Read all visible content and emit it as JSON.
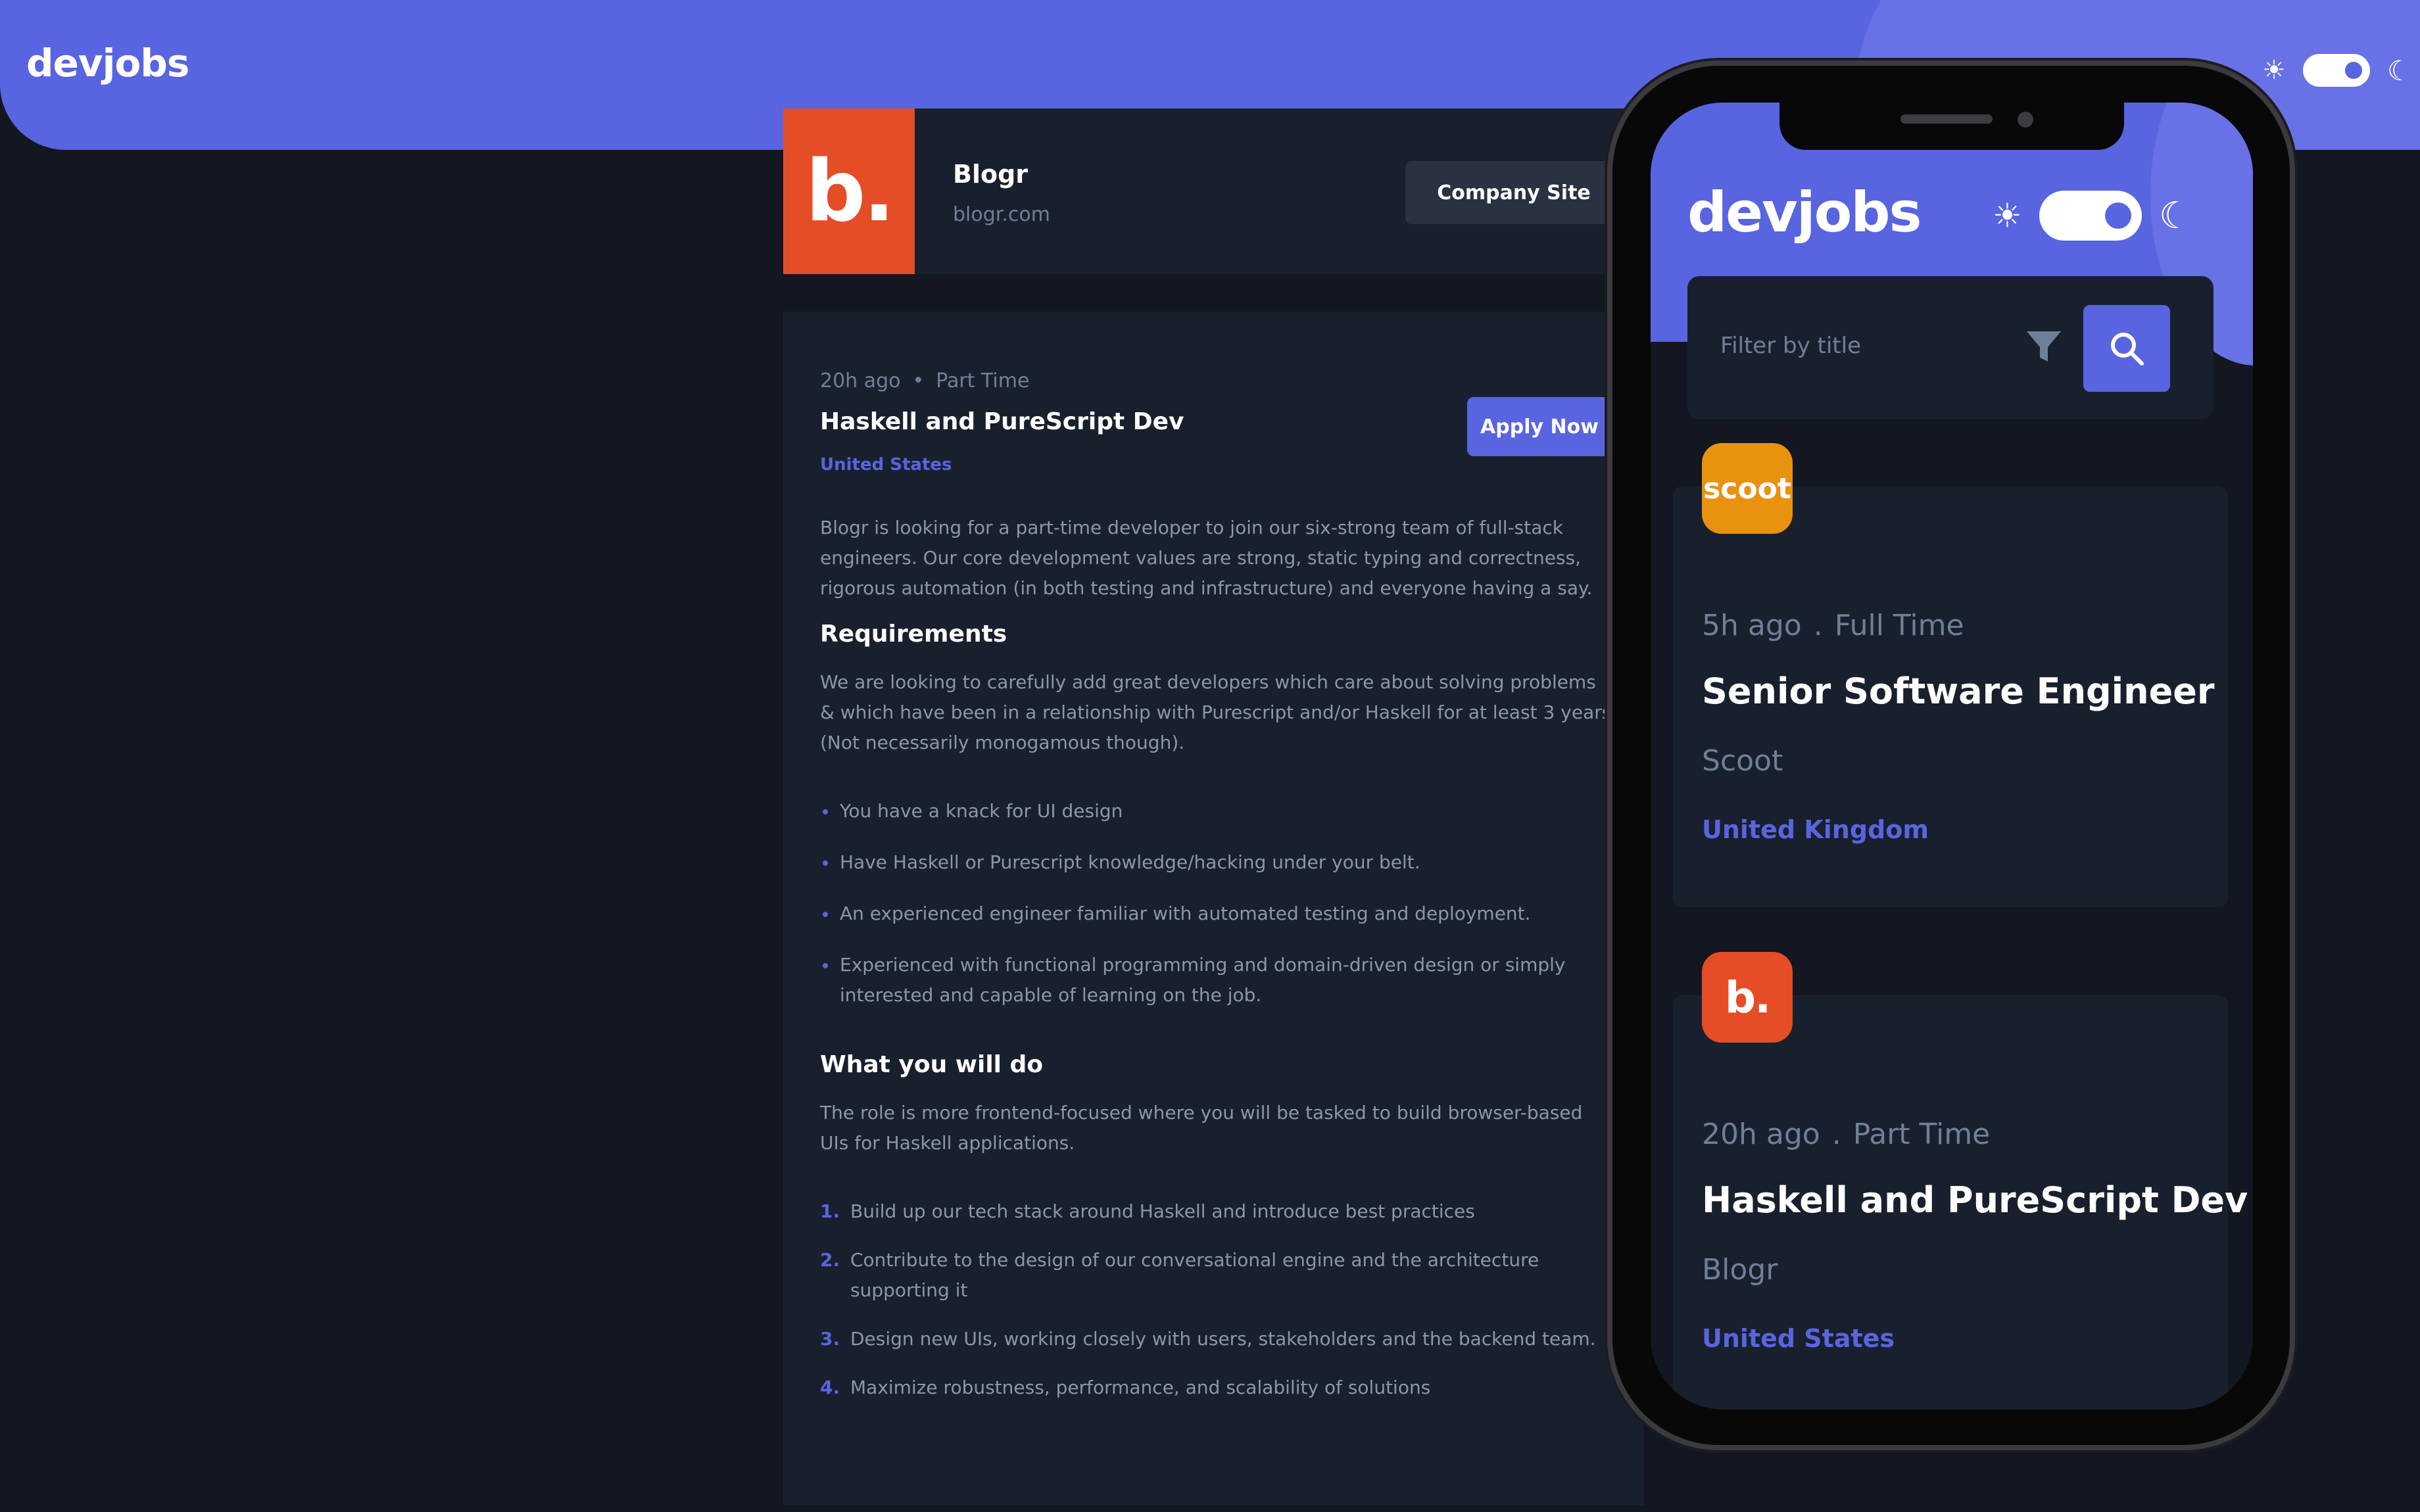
{
  "desktop": {
    "logo": "devjobs",
    "company": {
      "logo_text": "b.",
      "logo_color": "#e54d26",
      "name": "Blogr",
      "website": "blogr.com",
      "site_button": "Company Site"
    },
    "job": {
      "posted": "20h ago",
      "contract": "Part Time",
      "title": "Haskell and PureScript Dev",
      "location": "United States",
      "apply_button": "Apply Now",
      "description": "Blogr is looking for a part-time developer to join our six-strong team of full-stack engineers. Our core development values are strong, static typing and correctness, rigorous automation (in both testing and infrastructure) and everyone having a say.",
      "requirements": {
        "heading": "Requirements",
        "content": "We are looking to carefully add great developers which care about solving problems & which have been in a relationship with Purescript and/or Haskell for at least 3 years (Not necessarily monogamous though).",
        "items": [
          "You have a knack for UI design",
          "Have Haskell or Purescript knowledge/hacking under your belt.",
          "An experienced engineer familiar with automated testing and deployment.",
          "Experienced with functional programming and domain-driven design or simply interested and capable of learning on the job."
        ]
      },
      "role": {
        "heading": "What you will do",
        "content": "The role is more frontend-focused where you will be tasked to build browser-based UIs for Haskell applications.",
        "items": [
          {
            "num": "1.",
            "text": "Build up our tech stack around Haskell and introduce best practices"
          },
          {
            "num": "2.",
            "text": "Contribute to the design of our conversational engine and the architecture supporting it"
          },
          {
            "num": "3.",
            "text": "Design new UIs, working closely with users, stakeholders and the backend team."
          },
          {
            "num": "4.",
            "text": "Maximize robustness, performance, and scalability of solutions"
          }
        ]
      }
    }
  },
  "mobile": {
    "logo": "devjobs",
    "search": {
      "placeholder": "Filter by title"
    },
    "cards": [
      {
        "logo_text": "scoot",
        "logo_color": "#e99210",
        "posted": "5h ago",
        "contract": "Full Time",
        "title": "Senior Software Engineer",
        "company": "Scoot",
        "location": "United Kingdom"
      },
      {
        "logo_text": "b.",
        "logo_color": "#e54d26",
        "posted": "20h ago",
        "contract": "Part Time",
        "title": "Haskell and PureScript Dev",
        "company": "Blogr",
        "location": "United States"
      }
    ]
  },
  "colors": {
    "accent": "#5964e0",
    "background": "#121721",
    "card": "#19202d",
    "muted_text": "#6e8098"
  },
  "icons": {
    "sun": "sun-icon",
    "moon": "moon-icon",
    "filter": "filter-icon",
    "search": "search-icon"
  }
}
